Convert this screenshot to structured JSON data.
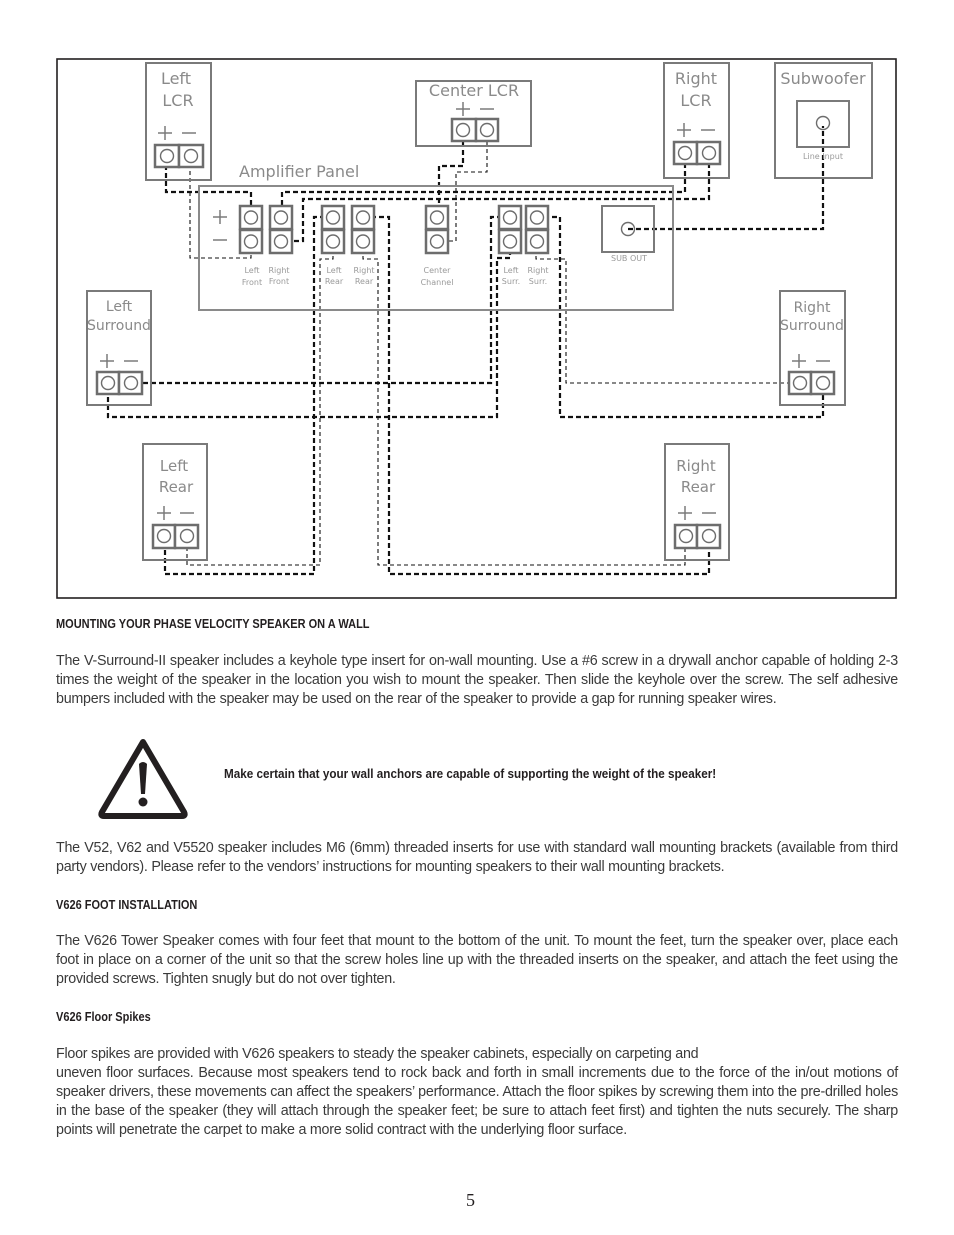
{
  "diagram": {
    "speakers": {
      "left_lcr": {
        "line1": "Left",
        "line2": "LCR"
      },
      "center_lcr": {
        "line1": "Center LCR"
      },
      "right_lcr": {
        "line1": "Right",
        "line2": "LCR"
      },
      "subwoofer": {
        "line1": "Subwoofer",
        "input_label": "Line Input"
      },
      "left_surround": {
        "line1": "Left",
        "line2": "Surround"
      },
      "right_surround": {
        "line1": "Right",
        "line2": "Surround"
      },
      "left_rear": {
        "line1": "Left",
        "line2": "Rear"
      },
      "right_rear": {
        "line1": "Right",
        "line2": "Rear"
      }
    },
    "amplifier_panel": {
      "title": "Amplifier Panel",
      "plus": "+",
      "minus": "—",
      "channels": [
        {
          "line1": "Left",
          "line2": "Front"
        },
        {
          "line1": "Right",
          "line2": "Front"
        },
        {
          "line1": "Left",
          "line2": "Rear"
        },
        {
          "line1": "Right",
          "line2": "Rear"
        },
        {
          "line1": "Center",
          "line2": "Channel"
        },
        {
          "line1": "Left",
          "line2": "Surr."
        },
        {
          "line1": "Right",
          "line2": "Surr."
        }
      ],
      "sub_out_label": "SUB OUT"
    },
    "polarity": {
      "plus": "+",
      "minus": "—"
    }
  },
  "sections": {
    "wall_mount": {
      "heading": "MOUNTING YOUR PHASE VELOCITY SPEAKER ON A WALL",
      "paragraph": "The V-Surround-II  speaker includes a keyhole type insert for on-wall mounting. Use a #6 screw in a drywall anchor capable of holding 2-3 times the weight of the speaker in the location you wish to mount the speaker. Then slide the keyhole over the screw.  The self adhesive bumpers included with the speaker may be used on the rear of the speaker to provide a gap for running speaker wires.",
      "warning": "Make certain that your wall anchors are capable of supporting the weight of the speaker!",
      "paragraph2": "The V52, V62 and V5520 speaker includes M6 (6mm) threaded inserts for use with standard wall mounting brackets (available from third party vendors). Please refer to the vendors’ instructions for mounting speakers to their wall mounting brackets."
    },
    "foot_install": {
      "heading": "V626 FOOT INSTALLATION",
      "paragraph": "The V626 Tower Speaker comes with four feet that mount to the bottom of the unit.  To mount the feet, turn the speaker over, place each foot in place on a corner of the unit so that the screw holes line up with the threaded inserts on the speaker, and attach the feet using the provided screws. Tighten snugly but do not over tighten."
    },
    "floor_spikes": {
      "heading": "V626 Floor Spikes",
      "line1": "Floor spikes are provided with V626 speakers to steady the speaker cabinets, especially on carpeting and",
      "paragraph": "uneven floor surfaces. Because most speakers tend to rock back and forth in small increments due to the force of the in/out motions of speaker drivers, these movements can affect the speakers’ performance. Attach the floor spikes by screwing them into the pre-drilled holes in the base of the speaker (they will attach through the speaker feet; be sure to attach feet first) and tighten the nuts securely. The sharp points will penetrate the carpet to make a more solid contract with the underlying floor surface."
    }
  },
  "page_number": "5"
}
